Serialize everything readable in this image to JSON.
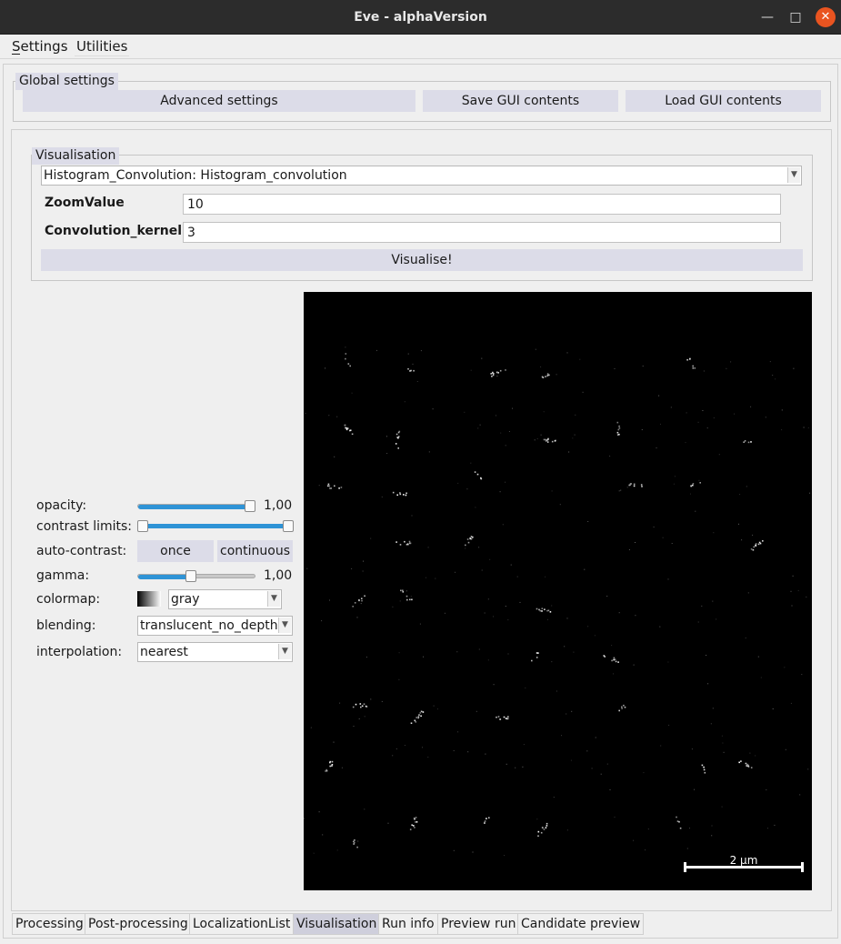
{
  "window": {
    "title": "Eve - alphaVersion"
  },
  "menubar": {
    "items": [
      "Settings",
      "Utilities"
    ]
  },
  "global_settings": {
    "legend": "Global settings",
    "advanced_label": "Advanced settings",
    "save_label": "Save GUI contents",
    "load_label": "Load GUI contents"
  },
  "visualisation": {
    "legend": "Visualisation",
    "method_selected": "Histogram_Convolution: Histogram_convolution",
    "zoom_label": "ZoomValue",
    "zoom_value": "10",
    "kernel_label": "Convolution_kernel",
    "kernel_value": "3",
    "visualise_label": "Visualise!"
  },
  "layer_controls": {
    "opacity_label": "opacity:",
    "opacity_value": "1,00",
    "opacity_level": 1.0,
    "contrast_label": "contrast limits:",
    "contrast_range": [
      0.0,
      1.0
    ],
    "autocontrast_label": "auto-contrast:",
    "once_label": "once",
    "continuous_label": "continuous",
    "gamma_label": "gamma:",
    "gamma_value": "1,00",
    "gamma_level": 0.45,
    "colormap_label": "colormap:",
    "colormap_value": "gray",
    "blending_label": "blending:",
    "blending_value": "translucent_no_depth",
    "interpolation_label": "interpolation:",
    "interpolation_value": "nearest"
  },
  "viewer": {
    "scalebar_label": "2 µm",
    "background": "#000000",
    "point_color": "#ffffff"
  },
  "tabs": [
    "Processing",
    "Post-processing",
    "LocalizationList",
    "Visualisation",
    "Run info",
    "Preview run",
    "Candidate preview"
  ],
  "active_tab": "Visualisation",
  "icons": {
    "close": "close-icon",
    "maximize": "maximize-icon",
    "minimize": "minimize-icon",
    "dropdown": "chevron-down-icon"
  },
  "colors": {
    "accent": "#2e93d6",
    "close_button": "#e95420",
    "button_bg": "#dcdce8"
  }
}
